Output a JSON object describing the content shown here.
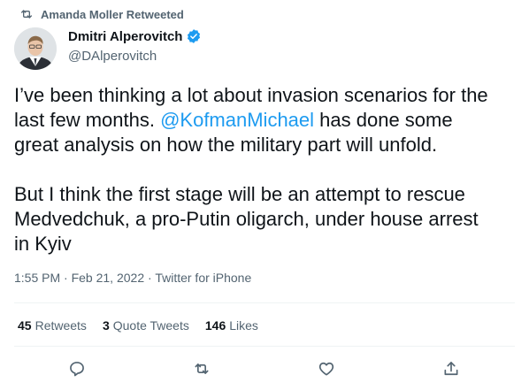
{
  "retweet_context": {
    "icon": "retweet-icon",
    "text": "Amanda Moller Retweeted"
  },
  "author": {
    "display_name": "Dmitri Alperovitch",
    "handle": "@DAlperovitch",
    "verified": true,
    "verified_color": "#1d9bf0"
  },
  "tweet": {
    "paragraph1_line1": "I’ve been thinking a lot about invasion scenarios for the",
    "paragraph1_line2_pre": "last few months. ",
    "mention": "@KofmanMichael",
    "paragraph1_line2_post": " has done some",
    "paragraph1_line3": "great analysis on how the military part will unfold.",
    "paragraph2_line1": "But I think the first stage will be an attempt to rescue",
    "paragraph2_line2": "Medvedchuk, a pro-Putin oligarch, under house arrest",
    "paragraph2_line3": "in Kyiv",
    "link_color": "#1d9bf0"
  },
  "meta": {
    "time": "1:55 PM",
    "date": "Feb 21, 2022",
    "source": "Twitter for iPhone",
    "separator": "·"
  },
  "stats": {
    "retweets_count": "45",
    "retweets_label": "Retweets",
    "quotes_count": "3",
    "quotes_label": "Quote Tweets",
    "likes_count": "146",
    "likes_label": "Likes"
  },
  "actions": [
    {
      "name": "reply",
      "icon": "reply-icon"
    },
    {
      "name": "retweet",
      "icon": "retweet-icon"
    },
    {
      "name": "like",
      "icon": "heart-icon"
    },
    {
      "name": "share",
      "icon": "share-icon"
    }
  ]
}
